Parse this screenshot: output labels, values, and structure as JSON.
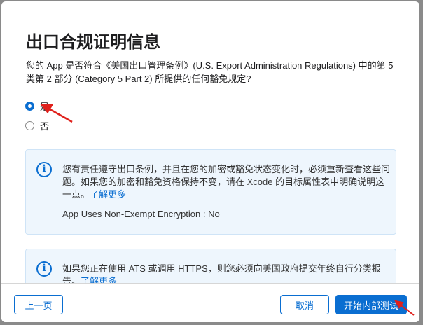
{
  "dialog": {
    "title": "出口合规证明信息",
    "question": "您的 App 是否符合《美国出口管理条例》(U.S. Export Administration Regulations) 中的第 5 类第 2 部分 (Category 5 Part 2) 所提供的任何豁免规定?",
    "options": [
      {
        "label": "是",
        "selected": true
      },
      {
        "label": "否",
        "selected": false
      }
    ],
    "info1": {
      "text": "您有责任遵守出口条例，并且在您的加密或豁免状态变化时，必须重新查看这些问题。如果您的加密和豁免资格保持不变，请在 Xcode 的目标属性表中明确说明这一点。",
      "link": "了解更多",
      "status": "App Uses Non-Exempt Encryption : No"
    },
    "info2": {
      "text": "如果您正在使用 ATS 或调用 HTTPS，则您必须向美国政府提交年终自行分类报告。",
      "link": "了解更多"
    }
  },
  "footer": {
    "back": "上一页",
    "cancel": "取消",
    "start": "开始内部测试"
  },
  "colors": {
    "accent": "#0a6ed1",
    "annotation": "#e0201b"
  }
}
